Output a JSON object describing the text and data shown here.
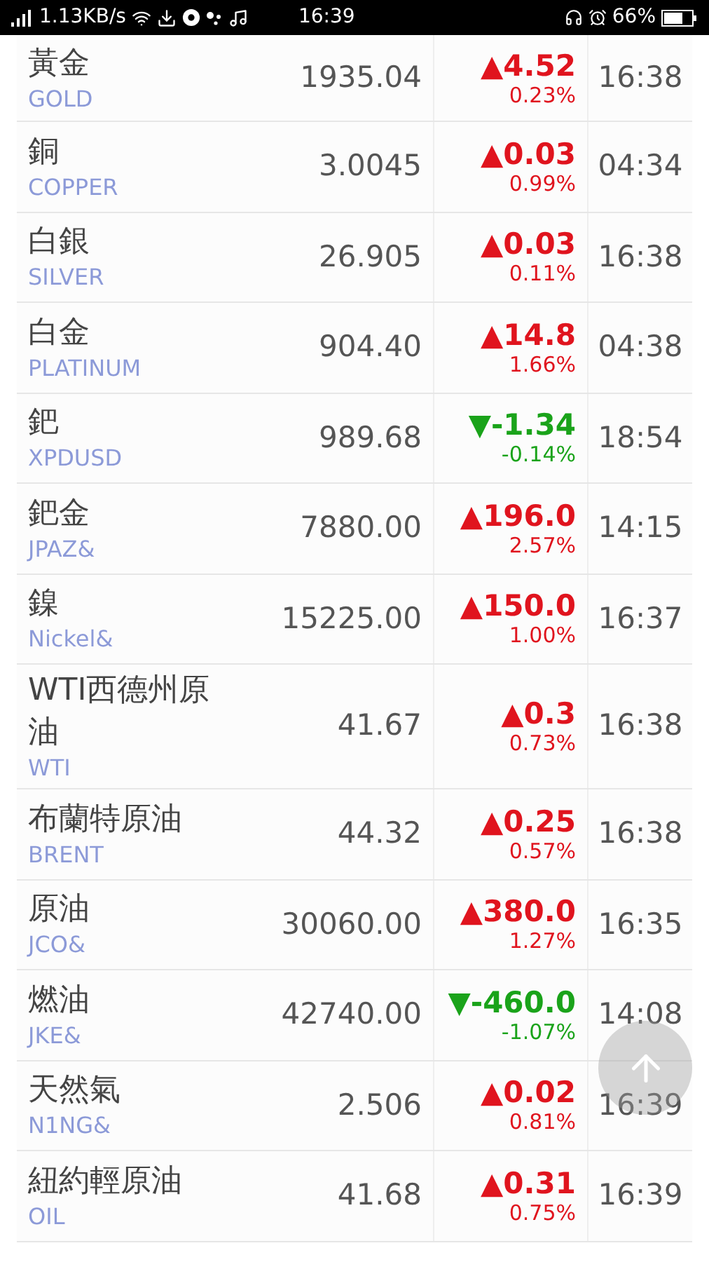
{
  "status_bar": {
    "speed": "1.13KB/s",
    "time": "16:39",
    "battery": "66%"
  },
  "rows": [
    {
      "name": "黃金",
      "code": "GOLD",
      "price": "1935.04",
      "kind": "up",
      "change": "▲4.52",
      "percent": "0.23%",
      "time": "16:38"
    },
    {
      "name": "銅",
      "code": "COPPER",
      "price": "3.0045",
      "kind": "up",
      "change": "▲0.03",
      "percent": "0.99%",
      "time": "04:34"
    },
    {
      "name": "白銀",
      "code": "SILVER",
      "price": "26.905",
      "kind": "up",
      "change": "▲0.03",
      "percent": "0.11%",
      "time": "16:38"
    },
    {
      "name": "白金",
      "code": "PLATINUM",
      "price": "904.40",
      "kind": "up",
      "change": "▲14.8",
      "percent": "1.66%",
      "time": "04:38"
    },
    {
      "name": "鈀",
      "code": "XPDUSD",
      "price": "989.68",
      "kind": "down",
      "change": "▼-1.34",
      "percent": "-0.14%",
      "time": "18:54"
    },
    {
      "name": "鈀金",
      "code": "JPAZ&",
      "price": "7880.00",
      "kind": "up",
      "change": "▲196.0",
      "percent": "2.57%",
      "time": "14:15"
    },
    {
      "name": "鎳",
      "code": "Nickel&",
      "price": "15225.00",
      "kind": "up",
      "change": "▲150.0",
      "percent": "1.00%",
      "time": "16:37"
    },
    {
      "name": "WTI西德州原油",
      "code": "WTI",
      "price": "41.67",
      "kind": "up",
      "change": "▲0.3",
      "percent": "0.73%",
      "time": "16:38"
    },
    {
      "name": "布蘭特原油",
      "code": "BRENT",
      "price": "44.32",
      "kind": "up",
      "change": "▲0.25",
      "percent": "0.57%",
      "time": "16:38"
    },
    {
      "name": "原油",
      "code": "JCO&",
      "price": "30060.00",
      "kind": "up",
      "change": "▲380.0",
      "percent": "1.27%",
      "time": "16:35"
    },
    {
      "name": "燃油",
      "code": "JKE&",
      "price": "42740.00",
      "kind": "down",
      "change": "▼-460.0",
      "percent": "-1.07%",
      "time": "14:08"
    },
    {
      "name": "天然氣",
      "code": "N1NG&",
      "price": "2.506",
      "kind": "up",
      "change": "▲0.02",
      "percent": "0.81%",
      "time": "16:39"
    },
    {
      "name": "紐約輕原油",
      "code": "OIL",
      "price": "41.68",
      "kind": "up",
      "change": "▲0.31",
      "percent": "0.75%",
      "time": "16:39"
    }
  ]
}
